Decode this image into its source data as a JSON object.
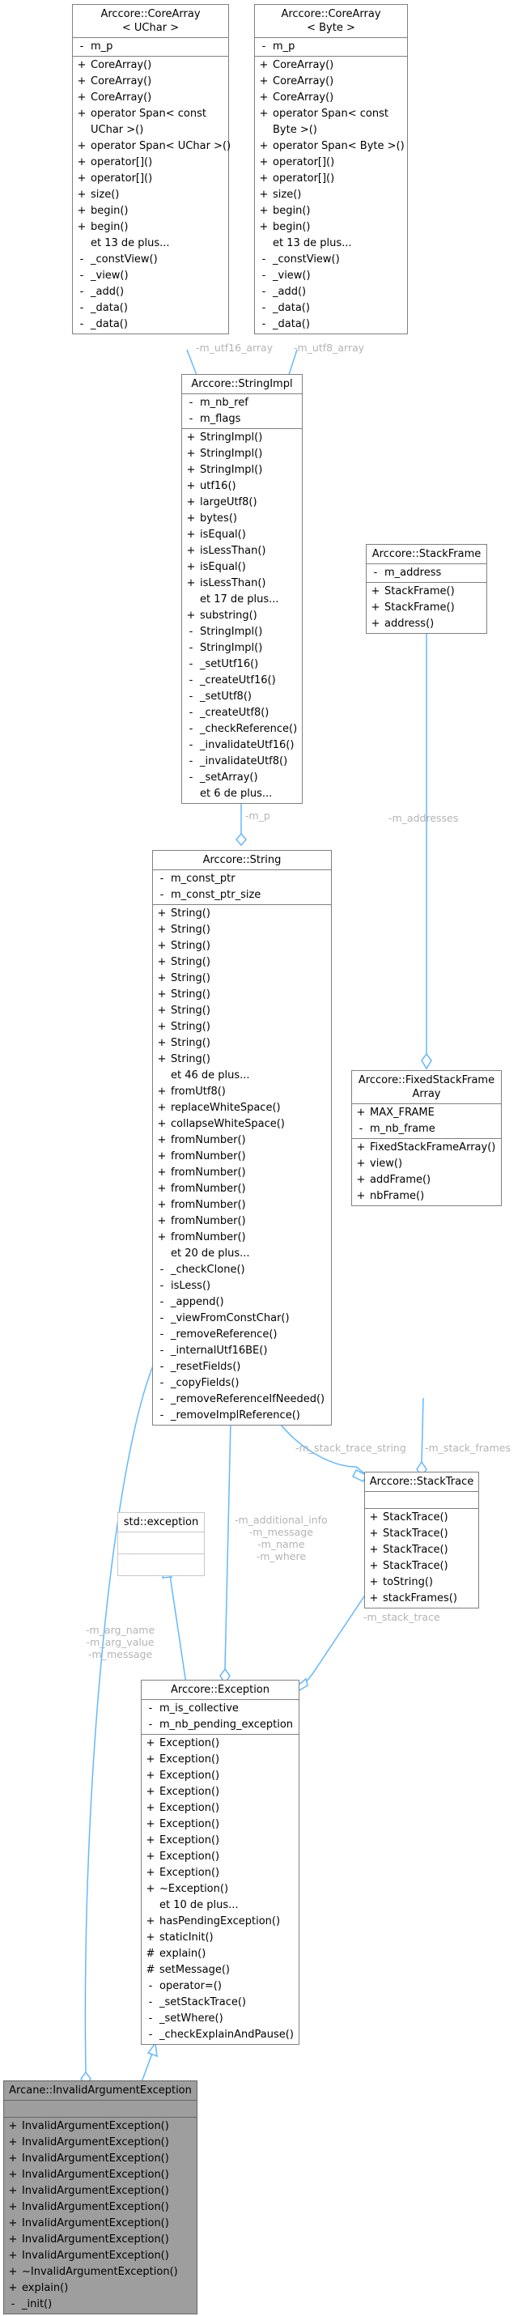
{
  "classes": {
    "corearray_uchar": {
      "title": "Arccore::CoreArray\n< UChar >",
      "attributes": [
        {
          "vis": "-",
          "name": "m_p"
        }
      ],
      "methods": [
        {
          "vis": "+",
          "name": "CoreArray()"
        },
        {
          "vis": "+",
          "name": "CoreArray()"
        },
        {
          "vis": "+",
          "name": "CoreArray()"
        },
        {
          "vis": "+",
          "name": "operator Span< const UChar >()"
        },
        {
          "vis": "+",
          "name": "operator Span< UChar >()"
        },
        {
          "vis": "+",
          "name": "operator[]()"
        },
        {
          "vis": "+",
          "name": "operator[]()"
        },
        {
          "vis": "+",
          "name": "size()"
        },
        {
          "vis": "+",
          "name": "begin()"
        },
        {
          "vis": "+",
          "name": "begin()"
        },
        {
          "vis": "",
          "name": "et 13 de plus..."
        },
        {
          "vis": "-",
          "name": "_constView()"
        },
        {
          "vis": "-",
          "name": "_view()"
        },
        {
          "vis": "-",
          "name": "_add()"
        },
        {
          "vis": "-",
          "name": "_data()"
        },
        {
          "vis": "-",
          "name": "_data()"
        }
      ]
    },
    "corearray_byte": {
      "title": "Arccore::CoreArray\n< Byte >",
      "attributes": [
        {
          "vis": "-",
          "name": "m_p"
        }
      ],
      "methods": [
        {
          "vis": "+",
          "name": "CoreArray()"
        },
        {
          "vis": "+",
          "name": "CoreArray()"
        },
        {
          "vis": "+",
          "name": "CoreArray()"
        },
        {
          "vis": "+",
          "name": "operator Span< const Byte >()"
        },
        {
          "vis": "+",
          "name": "operator Span< Byte >()"
        },
        {
          "vis": "+",
          "name": "operator[]()"
        },
        {
          "vis": "+",
          "name": "operator[]()"
        },
        {
          "vis": "+",
          "name": "size()"
        },
        {
          "vis": "+",
          "name": "begin()"
        },
        {
          "vis": "+",
          "name": "begin()"
        },
        {
          "vis": "",
          "name": "et 13 de plus..."
        },
        {
          "vis": "-",
          "name": "_constView()"
        },
        {
          "vis": "-",
          "name": "_view()"
        },
        {
          "vis": "-",
          "name": "_add()"
        },
        {
          "vis": "-",
          "name": "_data()"
        },
        {
          "vis": "-",
          "name": "_data()"
        }
      ]
    },
    "stringimpl": {
      "title": "Arccore::StringImpl",
      "attributes": [
        {
          "vis": "-",
          "name": "m_nb_ref"
        },
        {
          "vis": "-",
          "name": "m_flags"
        }
      ],
      "methods": [
        {
          "vis": "+",
          "name": "StringImpl()"
        },
        {
          "vis": "+",
          "name": "StringImpl()"
        },
        {
          "vis": "+",
          "name": "StringImpl()"
        },
        {
          "vis": "+",
          "name": "utf16()"
        },
        {
          "vis": "+",
          "name": "largeUtf8()"
        },
        {
          "vis": "+",
          "name": "bytes()"
        },
        {
          "vis": "+",
          "name": "isEqual()"
        },
        {
          "vis": "+",
          "name": "isLessThan()"
        },
        {
          "vis": "+",
          "name": "isEqual()"
        },
        {
          "vis": "+",
          "name": "isLessThan()"
        },
        {
          "vis": "",
          "name": "et 17 de plus..."
        },
        {
          "vis": "+",
          "name": "substring()"
        },
        {
          "vis": "-",
          "name": "StringImpl()"
        },
        {
          "vis": "-",
          "name": "StringImpl()"
        },
        {
          "vis": "-",
          "name": "_setUtf16()"
        },
        {
          "vis": "-",
          "name": "_createUtf16()"
        },
        {
          "vis": "-",
          "name": "_setUtf8()"
        },
        {
          "vis": "-",
          "name": "_createUtf8()"
        },
        {
          "vis": "-",
          "name": "_checkReference()"
        },
        {
          "vis": "-",
          "name": "_invalidateUtf16()"
        },
        {
          "vis": "-",
          "name": "_invalidateUtf8()"
        },
        {
          "vis": "-",
          "name": "_setArray()"
        },
        {
          "vis": "",
          "name": "et 6 de plus..."
        }
      ]
    },
    "stackframe": {
      "title": "Arccore::StackFrame",
      "attributes": [
        {
          "vis": "-",
          "name": "m_address"
        }
      ],
      "methods": [
        {
          "vis": "+",
          "name": "StackFrame()"
        },
        {
          "vis": "+",
          "name": "StackFrame()"
        },
        {
          "vis": "+",
          "name": "address()"
        }
      ]
    },
    "string": {
      "title": "Arccore::String",
      "attributes": [
        {
          "vis": "-",
          "name": "m_const_ptr"
        },
        {
          "vis": "-",
          "name": "m_const_ptr_size"
        }
      ],
      "methods": [
        {
          "vis": "+",
          "name": "String()"
        },
        {
          "vis": "+",
          "name": "String()"
        },
        {
          "vis": "+",
          "name": "String()"
        },
        {
          "vis": "+",
          "name": "String()"
        },
        {
          "vis": "+",
          "name": "String()"
        },
        {
          "vis": "+",
          "name": "String()"
        },
        {
          "vis": "+",
          "name": "String()"
        },
        {
          "vis": "+",
          "name": "String()"
        },
        {
          "vis": "+",
          "name": "String()"
        },
        {
          "vis": "+",
          "name": "String()"
        },
        {
          "vis": "",
          "name": "et 46 de plus..."
        },
        {
          "vis": "+",
          "name": "fromUtf8()"
        },
        {
          "vis": "+",
          "name": "replaceWhiteSpace()"
        },
        {
          "vis": "+",
          "name": "collapseWhiteSpace()"
        },
        {
          "vis": "+",
          "name": "fromNumber()"
        },
        {
          "vis": "+",
          "name": "fromNumber()"
        },
        {
          "vis": "+",
          "name": "fromNumber()"
        },
        {
          "vis": "+",
          "name": "fromNumber()"
        },
        {
          "vis": "+",
          "name": "fromNumber()"
        },
        {
          "vis": "+",
          "name": "fromNumber()"
        },
        {
          "vis": "+",
          "name": "fromNumber()"
        },
        {
          "vis": "",
          "name": "et 20 de plus..."
        },
        {
          "vis": "-",
          "name": "_checkClone()"
        },
        {
          "vis": "-",
          "name": "isLess()"
        },
        {
          "vis": "-",
          "name": "_append()"
        },
        {
          "vis": "-",
          "name": "_viewFromConstChar()"
        },
        {
          "vis": "-",
          "name": "_removeReference()"
        },
        {
          "vis": "-",
          "name": "_internalUtf16BE()"
        },
        {
          "vis": "-",
          "name": "_resetFields()"
        },
        {
          "vis": "-",
          "name": "_copyFields()"
        },
        {
          "vis": "-",
          "name": "_removeReferenceIfNeeded()"
        },
        {
          "vis": "-",
          "name": "_removeImplReference()"
        }
      ]
    },
    "fixedstackframearray": {
      "title": "Arccore::FixedStackFrame\nArray",
      "attributes": [
        {
          "vis": "+",
          "name": "MAX_FRAME"
        },
        {
          "vis": "-",
          "name": "m_nb_frame"
        }
      ],
      "methods": [
        {
          "vis": "+",
          "name": "FixedStackFrameArray()"
        },
        {
          "vis": "+",
          "name": "view()"
        },
        {
          "vis": "+",
          "name": "addFrame()"
        },
        {
          "vis": "+",
          "name": "nbFrame()"
        }
      ]
    },
    "stacktrace": {
      "title": "Arccore::StackTrace",
      "attributes": [],
      "methods": [
        {
          "vis": "+",
          "name": "StackTrace()"
        },
        {
          "vis": "+",
          "name": "StackTrace()"
        },
        {
          "vis": "+",
          "name": "StackTrace()"
        },
        {
          "vis": "+",
          "name": "StackTrace()"
        },
        {
          "vis": "+",
          "name": "toString()"
        },
        {
          "vis": "+",
          "name": "stackFrames()"
        }
      ]
    },
    "std_exception": {
      "title": "std::exception",
      "attributes": [],
      "methods": []
    },
    "exception": {
      "title": "Arccore::Exception",
      "attributes": [
        {
          "vis": "-",
          "name": "m_is_collective"
        },
        {
          "vis": "-",
          "name": "m_nb_pending_exception"
        }
      ],
      "methods": [
        {
          "vis": "+",
          "name": "Exception()"
        },
        {
          "vis": "+",
          "name": "Exception()"
        },
        {
          "vis": "+",
          "name": "Exception()"
        },
        {
          "vis": "+",
          "name": "Exception()"
        },
        {
          "vis": "+",
          "name": "Exception()"
        },
        {
          "vis": "+",
          "name": "Exception()"
        },
        {
          "vis": "+",
          "name": "Exception()"
        },
        {
          "vis": "+",
          "name": "Exception()"
        },
        {
          "vis": "+",
          "name": "Exception()"
        },
        {
          "vis": "+",
          "name": "~Exception()"
        },
        {
          "vis": "",
          "name": "et 10 de plus..."
        },
        {
          "vis": "+",
          "name": "hasPendingException()"
        },
        {
          "vis": "+",
          "name": "staticInit()"
        },
        {
          "vis": "#",
          "name": "explain()"
        },
        {
          "vis": "#",
          "name": "setMessage()"
        },
        {
          "vis": "-",
          "name": "operator=()"
        },
        {
          "vis": "-",
          "name": "_setStackTrace()"
        },
        {
          "vis": "-",
          "name": "_setWhere()"
        },
        {
          "vis": "-",
          "name": "_checkExplainAndPause()"
        }
      ]
    },
    "invalidargumentexception": {
      "title": "Arcane::InvalidArgumentException",
      "attributes": [],
      "methods": [
        {
          "vis": "+",
          "name": "InvalidArgumentException()"
        },
        {
          "vis": "+",
          "name": "InvalidArgumentException()"
        },
        {
          "vis": "+",
          "name": "InvalidArgumentException()"
        },
        {
          "vis": "+",
          "name": "InvalidArgumentException()"
        },
        {
          "vis": "+",
          "name": "InvalidArgumentException()"
        },
        {
          "vis": "+",
          "name": "InvalidArgumentException()"
        },
        {
          "vis": "+",
          "name": "InvalidArgumentException()"
        },
        {
          "vis": "+",
          "name": "InvalidArgumentException()"
        },
        {
          "vis": "+",
          "name": "InvalidArgumentException()"
        },
        {
          "vis": "+",
          "name": "~InvalidArgumentException()"
        },
        {
          "vis": "+",
          "name": "explain()"
        },
        {
          "vis": "-",
          "name": "_init()"
        }
      ]
    }
  },
  "edge_labels": {
    "m_utf16_array": "-m_utf16_array",
    "m_utf8_array": "-m_utf8_array",
    "m_p": "-m_p",
    "m_addresses": "-m_addresses",
    "m_stack_trace_string": "-m_stack_trace_string",
    "m_stack_frames": "-m_stack_frames",
    "m_stack_trace": "-m_stack_trace",
    "exception_members": "-m_additional_info\n-m_message\n-m_name\n-m_where",
    "invalid_arg_members": "-m_arg_name\n-m_arg_value\n-m_message"
  },
  "colors": {
    "edge": "#63b8ff",
    "border": "#808080",
    "external_border": "#c8c8c8",
    "focus_fill": "#9e9e9e",
    "label": "#b4b4b4"
  }
}
